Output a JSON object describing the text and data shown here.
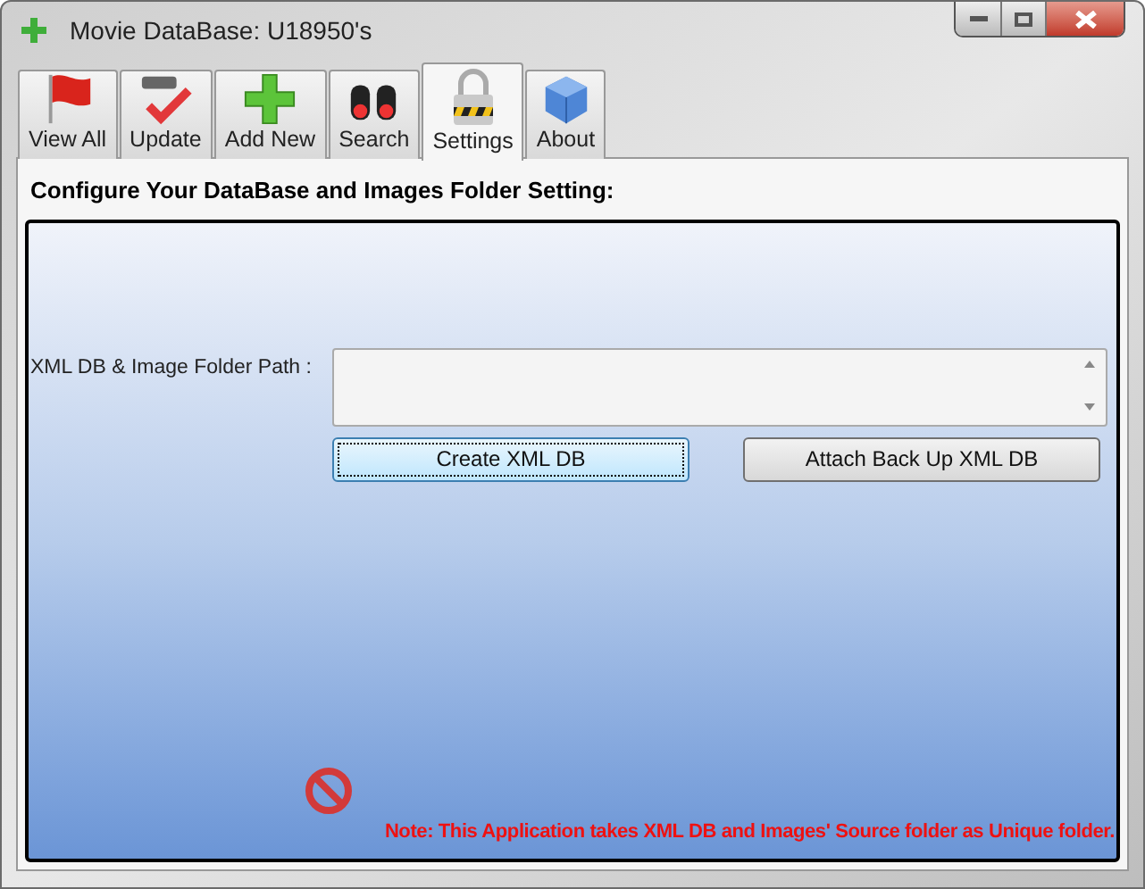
{
  "window": {
    "title": "Movie DataBase: U18950's"
  },
  "tabs": [
    {
      "label": "View All",
      "selected": false
    },
    {
      "label": "Update",
      "selected": false
    },
    {
      "label": "Add New",
      "selected": false
    },
    {
      "label": "Search",
      "selected": false
    },
    {
      "label": "Settings",
      "selected": true
    },
    {
      "label": "About",
      "selected": false
    }
  ],
  "heading": "Configure Your DataBase and Images Folder Setting:",
  "path_label": "XML DB & Image Folder Path :",
  "buttons": [
    {
      "label": "Create XML DB",
      "focused": true
    },
    {
      "label": "Attach Back Up XML DB",
      "focused": false
    }
  ],
  "note": "Note: This Application takes XML DB and Images' Source folder as Unique folder."
}
